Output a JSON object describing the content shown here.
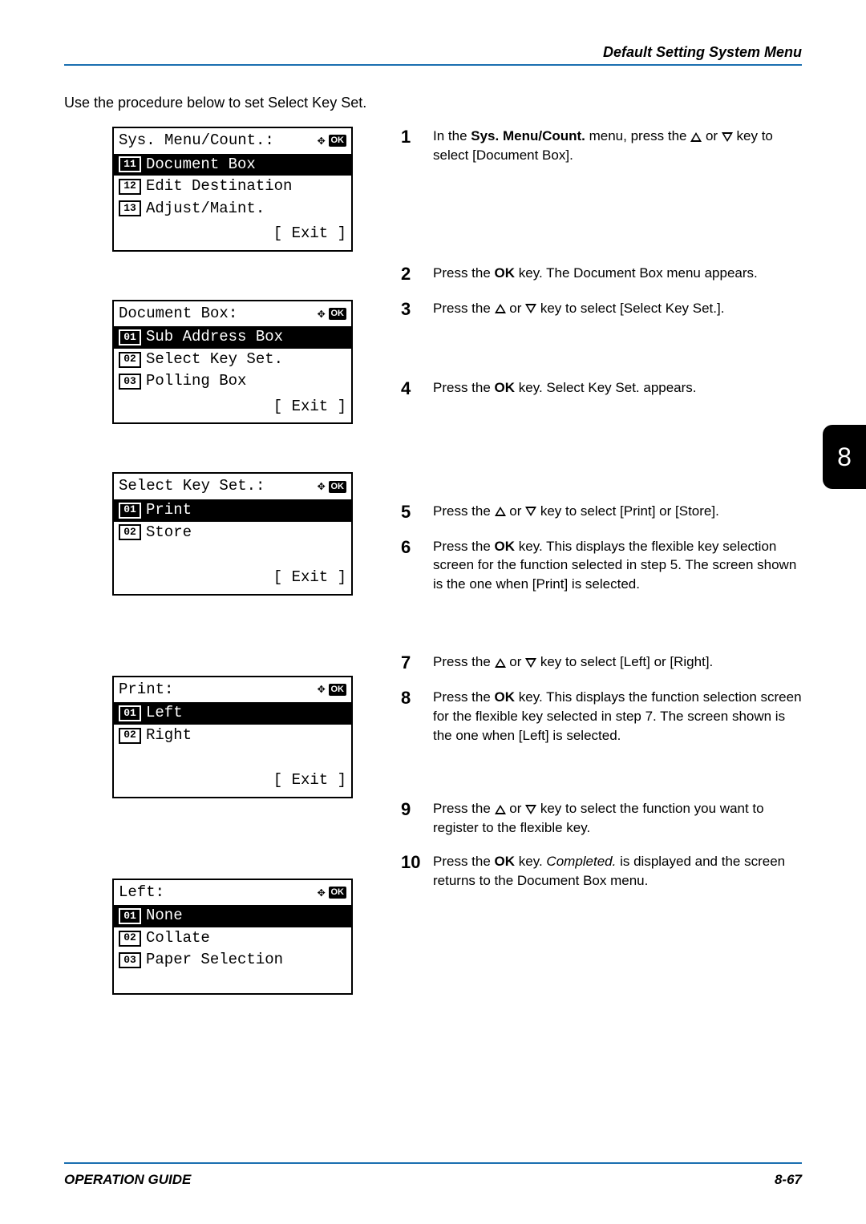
{
  "header": {
    "section": "Default Setting System Menu"
  },
  "intro": "Use the procedure below to set Select Key Set.",
  "chapter": "8",
  "footer": {
    "left": "OPERATION GUIDE",
    "right": "8-67"
  },
  "screens": {
    "s1": {
      "title": "Sys. Menu/Count.:",
      "items": [
        {
          "num": "11",
          "label": "Document Box",
          "selected": true
        },
        {
          "num": "12",
          "label": "Edit Destination",
          "selected": false
        },
        {
          "num": "13",
          "label": "Adjust/Maint.",
          "selected": false
        }
      ],
      "exit": "[  Exit   ]"
    },
    "s2": {
      "title": "Document Box:",
      "items": [
        {
          "num": "01",
          "label": "Sub Address Box",
          "selected": true
        },
        {
          "num": "02",
          "label": "Select Key Set.",
          "selected": false
        },
        {
          "num": "03",
          "label": "Polling Box",
          "selected": false
        }
      ],
      "exit": "[  Exit   ]"
    },
    "s3": {
      "title": "Select Key Set.:",
      "items": [
        {
          "num": "01",
          "label": "Print",
          "selected": true
        },
        {
          "num": "02",
          "label": "Store",
          "selected": false
        }
      ],
      "exit": "[  Exit   ]"
    },
    "s4": {
      "title": "Print:",
      "items": [
        {
          "num": "01",
          "label": "Left",
          "selected": true
        },
        {
          "num": "02",
          "label": "Right",
          "selected": false
        }
      ],
      "exit": "[  Exit   ]"
    },
    "s5": {
      "title": "Left:",
      "items": [
        {
          "num": "01",
          "label": "None",
          "selected": true
        },
        {
          "num": "02",
          "label": "Collate",
          "selected": false
        },
        {
          "num": "03",
          "label": "Paper Selection",
          "selected": false
        }
      ],
      "exit": ""
    }
  },
  "steps": {
    "n1": "1",
    "t1a": "In the ",
    "t1b": "Sys. Menu/Count.",
    "t1c": " menu, press the ",
    "t1d": " or ",
    "t1e": " key to select [Document Box].",
    "n2": "2",
    "t2a": "Press the ",
    "t2b": "OK",
    "t2c": " key. The Document Box menu appears.",
    "n3": "3",
    "t3a": "Press the ",
    "t3b": " or ",
    "t3c": " key to select [Select Key Set.].",
    "n4": "4",
    "t4a": "Press the ",
    "t4b": "OK",
    "t4c": " key. Select Key Set. appears.",
    "n5": "5",
    "t5a": "Press the ",
    "t5b": " or ",
    "t5c": " key to select [Print] or [Store].",
    "n6": "6",
    "t6a": "Press the ",
    "t6b": "OK",
    "t6c": " key. This displays the flexible key selection screen for the function selected in step 5. The screen shown is the one when [Print] is selected.",
    "n7": "7",
    "t7a": "Press the ",
    "t7b": " or ",
    "t7c": " key to select [Left] or [Right].",
    "n8": "8",
    "t8a": "Press the ",
    "t8b": "OK",
    "t8c": " key. This displays the function selection screen for the flexible key selected in step 7. The screen shown is the one when [Left] is selected.",
    "n9": "9",
    "t9a": "Press the ",
    "t9b": " or ",
    "t9c": " key to select the function you want to register to the flexible key.",
    "n10": "10",
    "t10a": "Press the ",
    "t10b": "OK",
    "t10c": " key. ",
    "t10d": "Completed.",
    "t10e": " is displayed and the screen returns to the Document Box menu."
  },
  "ok_label": "OK"
}
